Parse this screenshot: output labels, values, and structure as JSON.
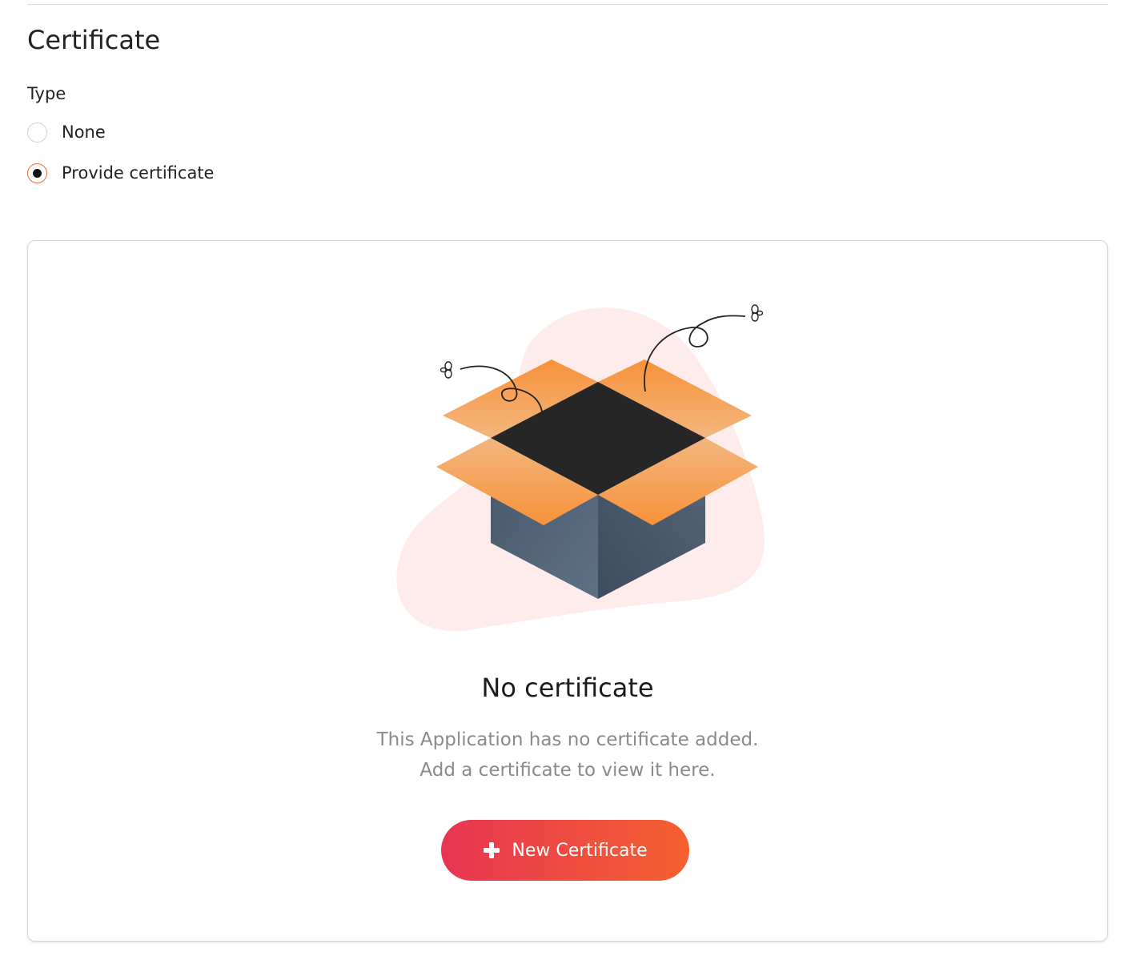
{
  "section": {
    "title": "Certificate"
  },
  "type_field": {
    "label": "Type",
    "options": [
      {
        "label": "None",
        "selected": false
      },
      {
        "label": "Provide certificate",
        "selected": true
      }
    ]
  },
  "empty_state": {
    "title": "No certificate",
    "description_line1": "This Application has no certificate added.",
    "description_line2": "Add a certificate to view it here.",
    "illustration": "open-box-illustration",
    "button": {
      "label": "New Certificate",
      "icon": "plus-icon"
    }
  },
  "colors": {
    "accent_orange": "#f26b2a",
    "button_gradient_start": "#e83553",
    "button_gradient_end": "#f4612f",
    "box_flap_orange": "#f7923a",
    "box_body": "#4a5a6b",
    "box_interior": "#262626",
    "blob_background": "#fdeceb"
  }
}
